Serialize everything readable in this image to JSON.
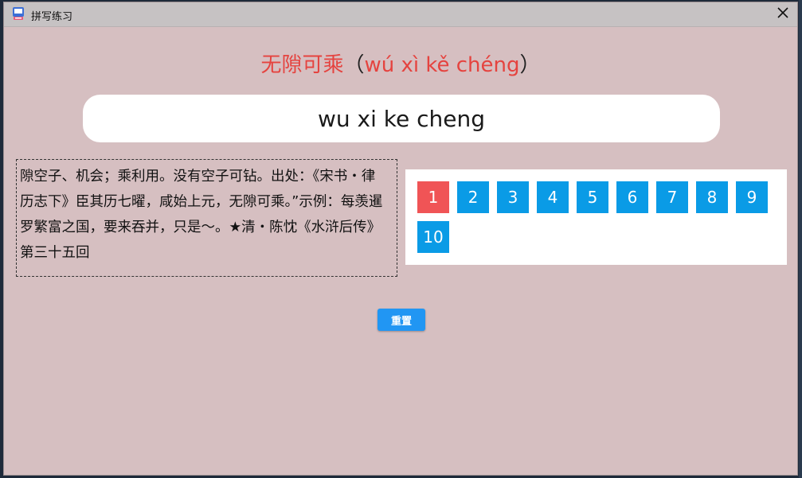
{
  "window": {
    "title": "拼写练习"
  },
  "word": {
    "hanzi": "无隙可乘",
    "paren_open": "（",
    "pinyin": "wú xì kě chéng",
    "paren_close": "）"
  },
  "answer": {
    "value": "wu xi ke cheng"
  },
  "definition": {
    "text": "隙空子、机会；乘利用。没有空子可钻。出处：《宋书・律历志下》臣其历七曜，咸始上元，无隙可乘。”示例：每羡暹罗繁富之国，要来吞并，只是～。★清・陈忱《水浒后传》第三十五回"
  },
  "pages": {
    "active": "1",
    "items": [
      "1",
      "2",
      "3",
      "4",
      "5",
      "6",
      "7",
      "8",
      "9",
      "10"
    ]
  },
  "actions": {
    "reset_label": "重置"
  },
  "colors": {
    "accent_red": "#e5433f",
    "page_blue": "#0a9be6",
    "page_active": "#f05456",
    "button_blue": "#2196f3",
    "window_bg": "#d6bfc1"
  }
}
